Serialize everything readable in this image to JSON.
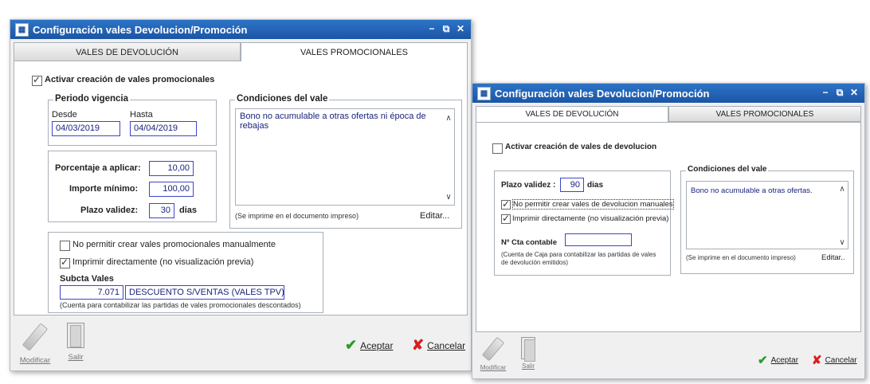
{
  "win1": {
    "title": "Configuración vales Devolucion/Promoción",
    "tabs": [
      "VALES DE DEVOLUCIÓN",
      "VALES PROMOCIONALES"
    ],
    "activar_label": "Activar creación de vales promocionales",
    "periodo": {
      "legend": "Periodo vigencia",
      "desde_label": "Desde",
      "hasta_label": "Hasta",
      "desde_value": "04/03/2019",
      "hasta_value": "04/04/2019"
    },
    "porcentaje_label": "Porcentaje a aplicar:",
    "porcentaje_value": "10,00",
    "importe_label": "Importe mínimo:",
    "importe_value": "100,00",
    "plazo_label": "Plazo validez:",
    "plazo_value": "30",
    "dias_label": "dias",
    "condiciones": {
      "legend": "Condiciones del vale",
      "text": "Bono no acumulable a otras ofertas ni época de rebajas",
      "note": "(Se imprime en el documento impreso)",
      "edit": "Editar..."
    },
    "no_permitir_label": "No permitir crear vales promocionales manualmente",
    "imprimir_label": "Imprimir directamente (no visualización previa)",
    "subcta_label": "Subcta Vales",
    "subcta_value": "7.071",
    "subcta_desc": "DESCUENTO S/VENTAS (VALES TPV)",
    "subcta_note": "(Cuenta para contabilizar las partidas de vales promocionales descontados)",
    "modificar": "Modificar",
    "salir": "Salir",
    "aceptar": "Aceptar",
    "cancelar": "Cancelar"
  },
  "win2": {
    "title": "Configuración vales Devolucion/Promoción",
    "tabs": [
      "VALES DE DEVOLUCIÓN",
      "VALES PROMOCIONALES"
    ],
    "activar_label": "Activar creación de vales de devolucion",
    "plazo_label": "Plazo validez :",
    "plazo_value": "90",
    "dias_label": "dias",
    "no_permitir_label": "No permitir crear vales de devolucion manuales",
    "imprimir_label": "Imprimir directamente (no visualización previa)",
    "cta_label": "Nº Cta contable",
    "cta_value": "",
    "cta_note": "(Cuenta de Caja para contabilizar las partidas de vales de devolución emitidos)",
    "condiciones": {
      "legend": "Condiciones del vale",
      "text": "Bono no acumulable a otras ofertas.",
      "note": "(Se imprime en el documento impreso)",
      "edit": "Editar.."
    },
    "modificar": "Modificar",
    "salir": "Salir",
    "aceptar": "Aceptar",
    "cancelar": "Cancelar"
  },
  "colors": {
    "title_bar": "#1b55a5",
    "field_border": "#3b47c7",
    "field_text": "#1a237e",
    "ok": "#2e9a2e",
    "cancel": "#d62020"
  },
  "icons": {
    "window": "app-window-icon",
    "modify": "pencil-icon",
    "exit": "door-icon",
    "ok": "checkmark-icon",
    "cancel": "x-icon"
  }
}
